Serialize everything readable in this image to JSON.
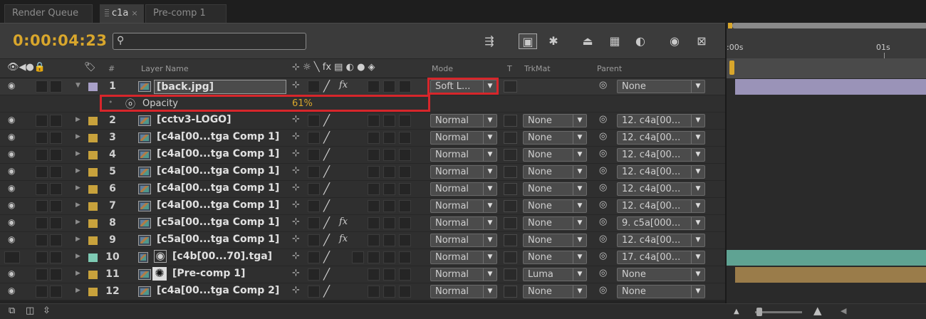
{
  "tabs": [
    {
      "label": "Render Queue"
    },
    {
      "label": "c1a",
      "close": "×"
    },
    {
      "label": "Pre-comp 1"
    }
  ],
  "toolbar": {
    "timecode": "0:00:04:23",
    "search": {
      "value": "",
      "placeholder": ""
    },
    "icons": [
      "composition-mini-flowchart-icon",
      "draft-3d-icon",
      "hide-shy-layers-icon",
      "frame-blending-icon",
      "motion-blur-icon",
      "brainstorm-icon",
      "auto-keyframe-icon",
      "graph-editor-icon"
    ]
  },
  "columns": {
    "layer_name": "Layer Name",
    "mode": "Mode",
    "t": "T",
    "trkmat": "TrkMat",
    "parent": "Parent",
    "hash": "#"
  },
  "layers": [
    {
      "num": "1",
      "name": "[back.jpg]",
      "label_color": "#a8a0c8",
      "mode": "Soft L...",
      "trkmat": "",
      "parent": "None",
      "fx": true,
      "selected": true
    },
    {
      "num": "2",
      "name": "[cctv3-LOGO]",
      "label_color": "#c8a23c",
      "mode": "Normal",
      "trkmat": "None",
      "parent": "12. c4a[00...",
      "fx": false
    },
    {
      "num": "3",
      "name": "[c4a[00...tga Comp 1]",
      "label_color": "#c8a23c",
      "mode": "Normal",
      "trkmat": "None",
      "parent": "12. c4a[00...",
      "fx": false
    },
    {
      "num": "4",
      "name": "[c4a[00...tga Comp 1]",
      "label_color": "#c8a23c",
      "mode": "Normal",
      "trkmat": "None",
      "parent": "12. c4a[00...",
      "fx": false
    },
    {
      "num": "5",
      "name": "[c4a[00...tga Comp 1]",
      "label_color": "#c8a23c",
      "mode": "Normal",
      "trkmat": "None",
      "parent": "12. c4a[00...",
      "fx": false
    },
    {
      "num": "6",
      "name": "[c4a[00...tga Comp 1]",
      "label_color": "#c8a23c",
      "mode": "Normal",
      "trkmat": "None",
      "parent": "12. c4a[00...",
      "fx": false
    },
    {
      "num": "7",
      "name": "[c4a[00...tga Comp 1]",
      "label_color": "#c8a23c",
      "mode": "Normal",
      "trkmat": "None",
      "parent": "12. c4a[00...",
      "fx": false
    },
    {
      "num": "8",
      "name": "[c5a[00...tga Comp 1]",
      "label_color": "#c8a23c",
      "mode": "Normal",
      "trkmat": "None",
      "parent": "9. c5a[000...",
      "fx": true
    },
    {
      "num": "9",
      "name": "[c5a[00...tga Comp 1]",
      "label_color": "#c8a23c",
      "mode": "Normal",
      "trkmat": "None",
      "parent": "12. c4a[00...",
      "fx": true
    },
    {
      "num": "10",
      "name": "[c4b[00...70].tga]",
      "label_color": "#7ecab4",
      "mode": "Normal",
      "trkmat": "None",
      "parent": "17. c4a[00...",
      "fx": false,
      "hidden": true
    },
    {
      "num": "11",
      "name": "[Pre-comp 1]",
      "label_color": "#c8a23c",
      "mode": "Normal",
      "trkmat": "Luma",
      "parent": "None",
      "fx": false
    },
    {
      "num": "12",
      "name": "[c4a[00...tga Comp 2]",
      "label_color": "#c8a23c",
      "mode": "Normal",
      "trkmat": "None",
      "parent": "None",
      "fx": false
    }
  ],
  "opacity": {
    "label": "Opacity",
    "value": "61%"
  },
  "timeline": {
    "ruler_labels": [
      ":00s",
      "01s"
    ],
    "bar_colors": {
      "1": "#9a93b8",
      "10": "#5fa393",
      "11": "#9a7c4a"
    }
  },
  "bottom": {
    "icons": [
      "comp-flowchart-icon",
      "toggle-switches-icon",
      "expand-collapse-icon",
      "zoom-out-icon",
      "zoom-in-icon"
    ]
  }
}
